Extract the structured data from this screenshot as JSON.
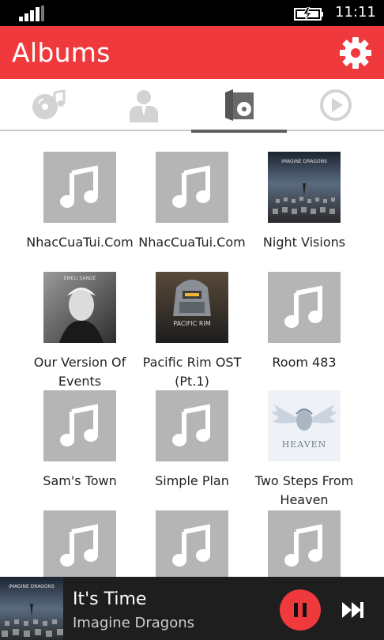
{
  "status_bar": {
    "time": "11:11",
    "signal_icon": "signal-bars-icon",
    "battery_icon": "battery-charging-icon"
  },
  "header": {
    "title": "Albums",
    "settings_icon": "gear-icon",
    "background": "#f0393d"
  },
  "tabs": [
    {
      "name": "songs",
      "icon": "disc-music-icon",
      "active": false
    },
    {
      "name": "artists",
      "icon": "person-icon",
      "active": false
    },
    {
      "name": "albums",
      "icon": "album-case-icon",
      "active": true
    },
    {
      "name": "now-playing",
      "icon": "play-circle-icon",
      "active": false
    }
  ],
  "albums": [
    {
      "name": "NhacCuaTui.Com",
      "art": "placeholder"
    },
    {
      "name": "NhacCuaTui.Com",
      "art": "placeholder"
    },
    {
      "name": "Night Visions",
      "art": "Imagine Dragons cover",
      "cover_brand": "IMAGINE DRAGONS"
    },
    {
      "name": "Our Version Of Events",
      "art": "Emeli Sandé cover",
      "cover_brand": "EMELI SANDÉ"
    },
    {
      "name": "Pacific Rim OST (Pt.1)",
      "art": "Pacific Rim cover",
      "cover_brand": "PACIFIC RIM"
    },
    {
      "name": "Room 483",
      "art": "placeholder"
    },
    {
      "name": "Sam's Town",
      "art": "placeholder"
    },
    {
      "name": "Simple Plan",
      "art": "placeholder"
    },
    {
      "name": "Two Steps From Heaven",
      "art": "Two Steps From Hell cover",
      "cover_brand": "HEAVEN"
    },
    {
      "name": "",
      "art": "placeholder"
    },
    {
      "name": "",
      "art": "placeholder"
    },
    {
      "name": "",
      "art": "placeholder"
    }
  ],
  "now_playing": {
    "title": "It's Time",
    "artist": "Imagine Dragons",
    "art_brand": "IMAGINE DRAGONS",
    "pause_icon": "pause-icon",
    "next_icon": "skip-next-icon",
    "accent": "#f0393d"
  }
}
